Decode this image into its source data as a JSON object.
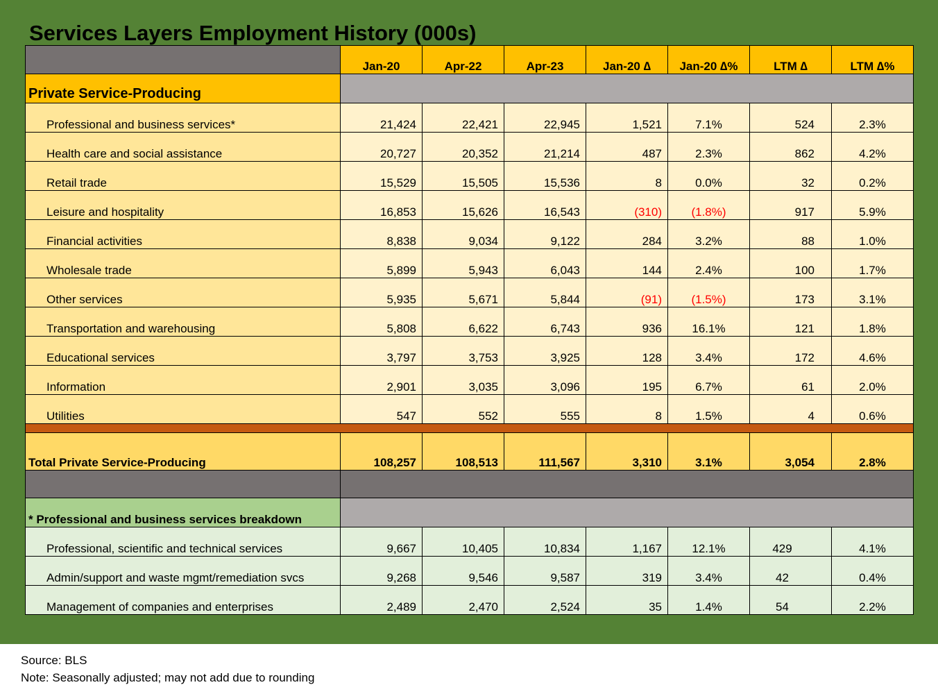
{
  "title": "Services Layers Employment History (000s)",
  "columns": [
    "Jan-20",
    "Apr-22",
    "Apr-23",
    "Jan-20 ∆",
    "Jan-20 ∆%",
    "LTM ∆",
    "LTM ∆%"
  ],
  "section_private": "Private Service-Producing",
  "rows": [
    {
      "label": "Professional and business services*",
      "values": [
        "21,424",
        "22,421",
        "22,945",
        "1,521",
        "7.1%",
        "524",
        "2.3%"
      ]
    },
    {
      "label": "Health care and social assistance",
      "values": [
        "20,727",
        "20,352",
        "21,214",
        "487",
        "2.3%",
        "862",
        "4.2%"
      ]
    },
    {
      "label": "Retail trade",
      "values": [
        "15,529",
        "15,505",
        "15,536",
        "8",
        "0.0%",
        "32",
        "0.2%"
      ]
    },
    {
      "label": "Leisure and hospitality",
      "values": [
        "16,853",
        "15,626",
        "16,543",
        "(310)",
        "(1.8%)",
        "917",
        "5.9%"
      ]
    },
    {
      "label": "Financial activities",
      "values": [
        "8,838",
        "9,034",
        "9,122",
        "284",
        "3.2%",
        "88",
        "1.0%"
      ]
    },
    {
      "label": "Wholesale trade",
      "values": [
        "5,899",
        "5,943",
        "6,043",
        "144",
        "2.4%",
        "100",
        "1.7%"
      ]
    },
    {
      "label": "Other services",
      "values": [
        "5,935",
        "5,671",
        "5,844",
        "(91)",
        "(1.5%)",
        "173",
        "3.1%"
      ]
    },
    {
      "label": "Transportation and warehousing",
      "values": [
        "5,808",
        "6,622",
        "6,743",
        "936",
        "16.1%",
        "121",
        "1.8%"
      ]
    },
    {
      "label": "Educational services",
      "values": [
        "3,797",
        "3,753",
        "3,925",
        "128",
        "3.4%",
        "172",
        "4.6%"
      ]
    },
    {
      "label": "Information",
      "values": [
        "2,901",
        "3,035",
        "3,096",
        "195",
        "6.7%",
        "61",
        "2.0%"
      ]
    },
    {
      "label": "Utilities",
      "values": [
        "547",
        "552",
        "555",
        "8",
        "1.5%",
        "4",
        "0.6%"
      ]
    }
  ],
  "total": {
    "label": "Total Private Service-Producing",
    "values": [
      "108,257",
      "108,513",
      "111,567",
      "3,310",
      "3.1%",
      "3,054",
      "2.8%"
    ]
  },
  "section_breakdown": "* Professional and business services breakdown",
  "breakdown_rows": [
    {
      "label": "Professional, scientific and technical services",
      "values": [
        "9,667",
        "10,405",
        "10,834",
        "1,167",
        "12.1%",
        "429",
        "4.1%"
      ]
    },
    {
      "label": "Admin/support and waste mgmt/remediation svcs",
      "values": [
        "9,268",
        "9,546",
        "9,587",
        "319",
        "3.4%",
        "42",
        "0.4%"
      ]
    },
    {
      "label": "Management of companies and enterprises",
      "values": [
        "2,489",
        "2,470",
        "2,524",
        "35",
        "1.4%",
        "54",
        "2.2%"
      ]
    }
  ],
  "source": "Source: BLS",
  "note": "Note: Seasonally adjusted; may not add due to rounding",
  "colors": {
    "background_panel": "#548235",
    "header_gray": "#767171",
    "section_gold": "#ffc000",
    "light_gray": "#aeaaaa",
    "row_yellow": "#fff2cc",
    "label_yellow": "#ffe699",
    "separator_orange": "#c55a11",
    "total_gold": "#ffd966",
    "green_label": "#a9d08e",
    "light_green": "#e2efda",
    "negative": "#ff0000"
  }
}
